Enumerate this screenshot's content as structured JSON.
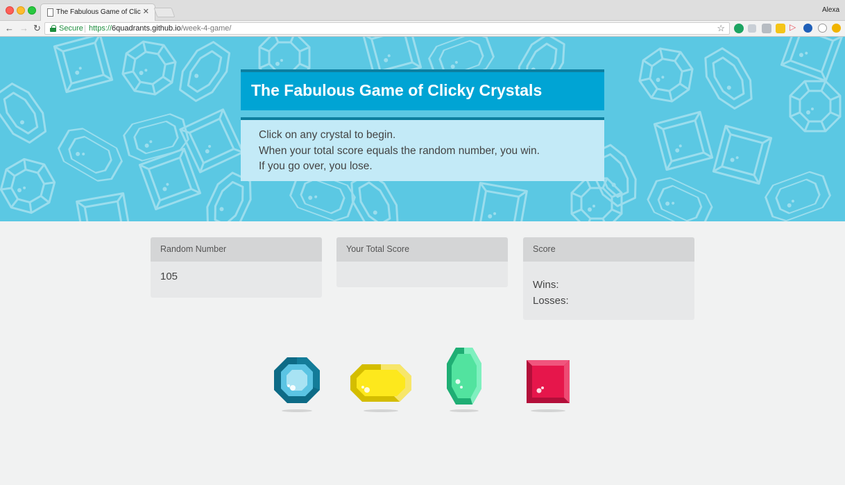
{
  "browser": {
    "tab_title": "The Fabulous Game of Clicky C",
    "profile_name": "Alexa",
    "secure_label": "Secure",
    "url_scheme": "https://",
    "url_host": "6quadrants.github.io",
    "url_path": "/week-4-game/"
  },
  "header": {
    "title": "The Fabulous Game of Clicky Crystals",
    "instructions": [
      "Click on any crystal to begin.",
      "When your total score equals the random number, you win.",
      "If you go over, you lose."
    ]
  },
  "panels": {
    "random": {
      "heading": "Random Number",
      "value": "105"
    },
    "total": {
      "heading": "Your Total Score",
      "value": ""
    },
    "score": {
      "heading": "Score",
      "wins_label": "Wins:",
      "losses_label": "Losses:"
    }
  },
  "crystals": [
    {
      "name": "blue-crystal",
      "color": "#5bc4e3"
    },
    {
      "name": "yellow-crystal",
      "color": "#fde81d"
    },
    {
      "name": "green-crystal",
      "color": "#52e39f"
    },
    {
      "name": "red-crystal",
      "color": "#e6164b"
    }
  ],
  "colors": {
    "hero_background": "#5bc8e3",
    "title_bar": "#00a4d4",
    "instructions_background": "#c3eaf7",
    "page_background": "#f1f2f2"
  }
}
